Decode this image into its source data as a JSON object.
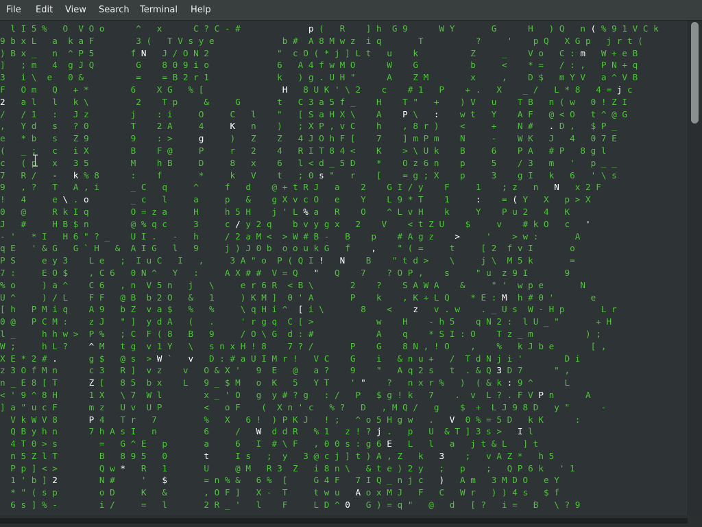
{
  "menubar": {
    "items": [
      "File",
      "Edit",
      "View",
      "Search",
      "Terminal",
      "Help"
    ]
  },
  "terminal": {
    "lines": [
      "  l I 5 %   O  V O o      ^   x      C ? C - #             p (   R    ] h  G 9      W Y       G      H   ) Q   n ( % 9 1 V C k",
      "9 b x L   a  k a F        3 (   T V s y e             b #  A 8 M w z  i q       T          ?     '    p Q   X G p   j r t (",
      ") B x _   n  ^ P 5       f N   J / O N 2             \"  c O ( * j ] L t   u    k          Z     _    V o   C : m   W + e B",
      "]   ; m   4  g J Q        G    8 0 9 i o             6   A 4 f w M O      W    G          b     <    * =   / : ,   P N + q",
      "3   i \\  e   0 &          =    = B 2 r 1             k   ) g . U H \"      A    Z M        x     ,    D $   m Y V   a ^ V B",
      "F   O m   Q   + *        6    X G   % [               H   8 U K ' \\ 2    c    # 1   P    + .   X    _ /   L * 8   4 = j c",
      "2   a l   l   k \\         2    T p     &     G       t   C 3 a 5 f _    H    T \"   +    ) V   u    T B   n ( w   0 ! Z I",
      "/   / 1   :   J z        j    : i     O     C   l    \"   [ S a H X \\    A    P \\   :    w t   Y    A F   @ < O   t ^ @ G",
      ",   Y d   s   ? 0        T    2 A     4     K   n    )   ; X P , v C    h    , 8 r )    <     +    N #   . D ,   $ P _",
      "e   * b   s   Z 9        9    : >     g     )   Z    Z   4 J O h F [    7    ] m P m    N     -    W K   J   4   0 7 E",
      "(   _ ;   c   i X        B    F @     P     r   2    4   R I T 8 4 <    K    > \\ U k    B     6    P A   # P   8 g l",
      "c   ( p   x   3 5        M    h B     D     8   x    6   l < d _ 5 D    *    O z 6 n    p     5    / 3   m   '   p _ _",
      "7   R /   -   k % 8      :    f       *     k   V    t   ; 0 s \"   r    [    = g ; X    p     3    g I   k   6   ' \\ s",
      "9   , ?   T   A , i      _ C   q     ^     f   d    @ + t R J   a    2    G I / y    F     1    ; z   n   N   x 2 F",
      "!   4     e \\ . o        _ c   l     a     p   &    g X v c O   e    Y    L 9 * T    1     :    = ( Y   X   p > X",
      "0   @     R k I q        O = z a     H     h 5 H    j ' L % a   R    O    ^ L v H    k     Y    P u 2   4   K",
      "J   #     H B $ n        @ % q c     3     c / y 2 q    b v y g x   2    V    < t Z U    $     v    # k O   c   '",
      "- '   * I   H 6 \" ? _    U I .   -   h     / 2 a M <  > W # B -   B    p    # A g z    >     '    > w :       A",
      "q E   ' & G   G ` H   &  A I G   l   9     j ) J 0 b  o o u k G   f    ,    \" ( =     t     [ 2  f v I       o",
      "P S     e y 3    L e   ;  I u C   I   ,     3 A \" o  P ( Q I !   N    B    \" t d >    \\     j \\  M 5 k       =",
      "7 :     E O $    , C 6   0 N ^   Y   :     A X # #  V = Q   \"   Q    7    ? O P ,    s     \" u  z 9 I       9",
      "% o     ) a ^    C 6   , n  V 5 n   j   \\     e r 6 R  < B \\       2    ?    S A W A    &     \" '  w p e       N",
      "U ^     ) / L    F F   @ B  b 2 O   &   1     ) K M ]  0 ' A       P    k    , K + L Q    * E : M  h # 0 '       e",
      "[ h   P M i q    A 9   b Z  v a $   %   %     \\ q H i ^  [ i \\       8    <    z   v . w    . _ U s  W - H p       L r",
      "0 @   P C M :    z J   \" ]  y d A   (   .     ' r g q  C [ >            w    H    - h 5    q N 2 :  l U _ \"       + H",
      "l _     h h w >  P %   ; C  F ( 8   B   9     / O \\ G  d : #            A    q    * S I : O    T z _ m          ) ;",
      "W ;     h L ?    ^ M   t g  v 1 Y   \\   s n x H ! 8    7 ? /       P    G    8 N , ! O    ,    %   k J b e       [ ,",
      "X E * 2 # .      g $   @ s  > W `   v   D : # a U I M r !   V C    G    i   & n u +   /  T d N j i '        D i",
      "z 3 O f M n      c 3   R ]  v z    v   O & X '   9  E   @   a ?    9    \"   A q 2 s   t  . & Q 3 D 7      \" ,",
      "n _ E 8 [ T      Z [   8 5  b x    L   9 _ $ M   o  K   5   Y T    ' \"    ?   n x r %   )  ( & k : 9 ^      L",
      "< ' 9 ^ 8 H      1 X   \\ 7  W l        x _ ' O   g  y # ? g   : /   P   $ g ! k   7    .  v  L ? . F V P n      A",
      "] a \" u c F      m z   U v  U P        <   o F    (  X n ' c   % ?   D   , M Q /   g    $  +  L J 9 8 D   y \"      -",
      "  V k W V 8      P 4   T r   7         %   X   6 !  ) P K J   ! ;   ^ o 5 H g w   .   V  0 % = 5 D   k K      :",
      "  Q B y h n      7 h A s I   n         6     /   W  d d R   % 1   z ! ? j .   p   U  & T ] 3 s >   I l",
      "  4 T 0 > s        =   G ^ E   p       a     6   I  # \\ F   , 0 0 s : g 6 E   L   l   a   j t & L   ] t",
      "  n 5 Z l T        B   8 9 5   0       t     I s   ;  y   3 @ c j ] t ) A , Z   k   3    ;   v A Z *   h 5",
      "  P p ] < >        Q w *   R   1       U     @ M   R 3  Z   i 8 n \\   & t e ) 2 y   ;   p    ;   Q P 6 k   ' 1",
      "  1 ' b ] 2        N #     '   $       = n % &   6 %  [     G 4 F   7 I Q _ n j c   )   A m   3 M D O   e Y",
      "  * \" ( s p        o D     K   &       , O F ]   X -  T     t w u   A o x M J   F   C   W r   ) ) 4 s   $ f",
      "  6 s ] % -        i /     =   l       2 R _ '   l    F     L D ^ 0   G ) = q \"   @   d   [ ?   i =   B   \\ ? 9"
    ]
  },
  "colors": {
    "menubar_bg": "#393f3f",
    "terminal_bg": "#2e3436",
    "matrix_green": "#4fc43a",
    "highlight": "#ffffff"
  },
  "icons": {
    "cursor": "text-cursor-ibeam-icon"
  }
}
